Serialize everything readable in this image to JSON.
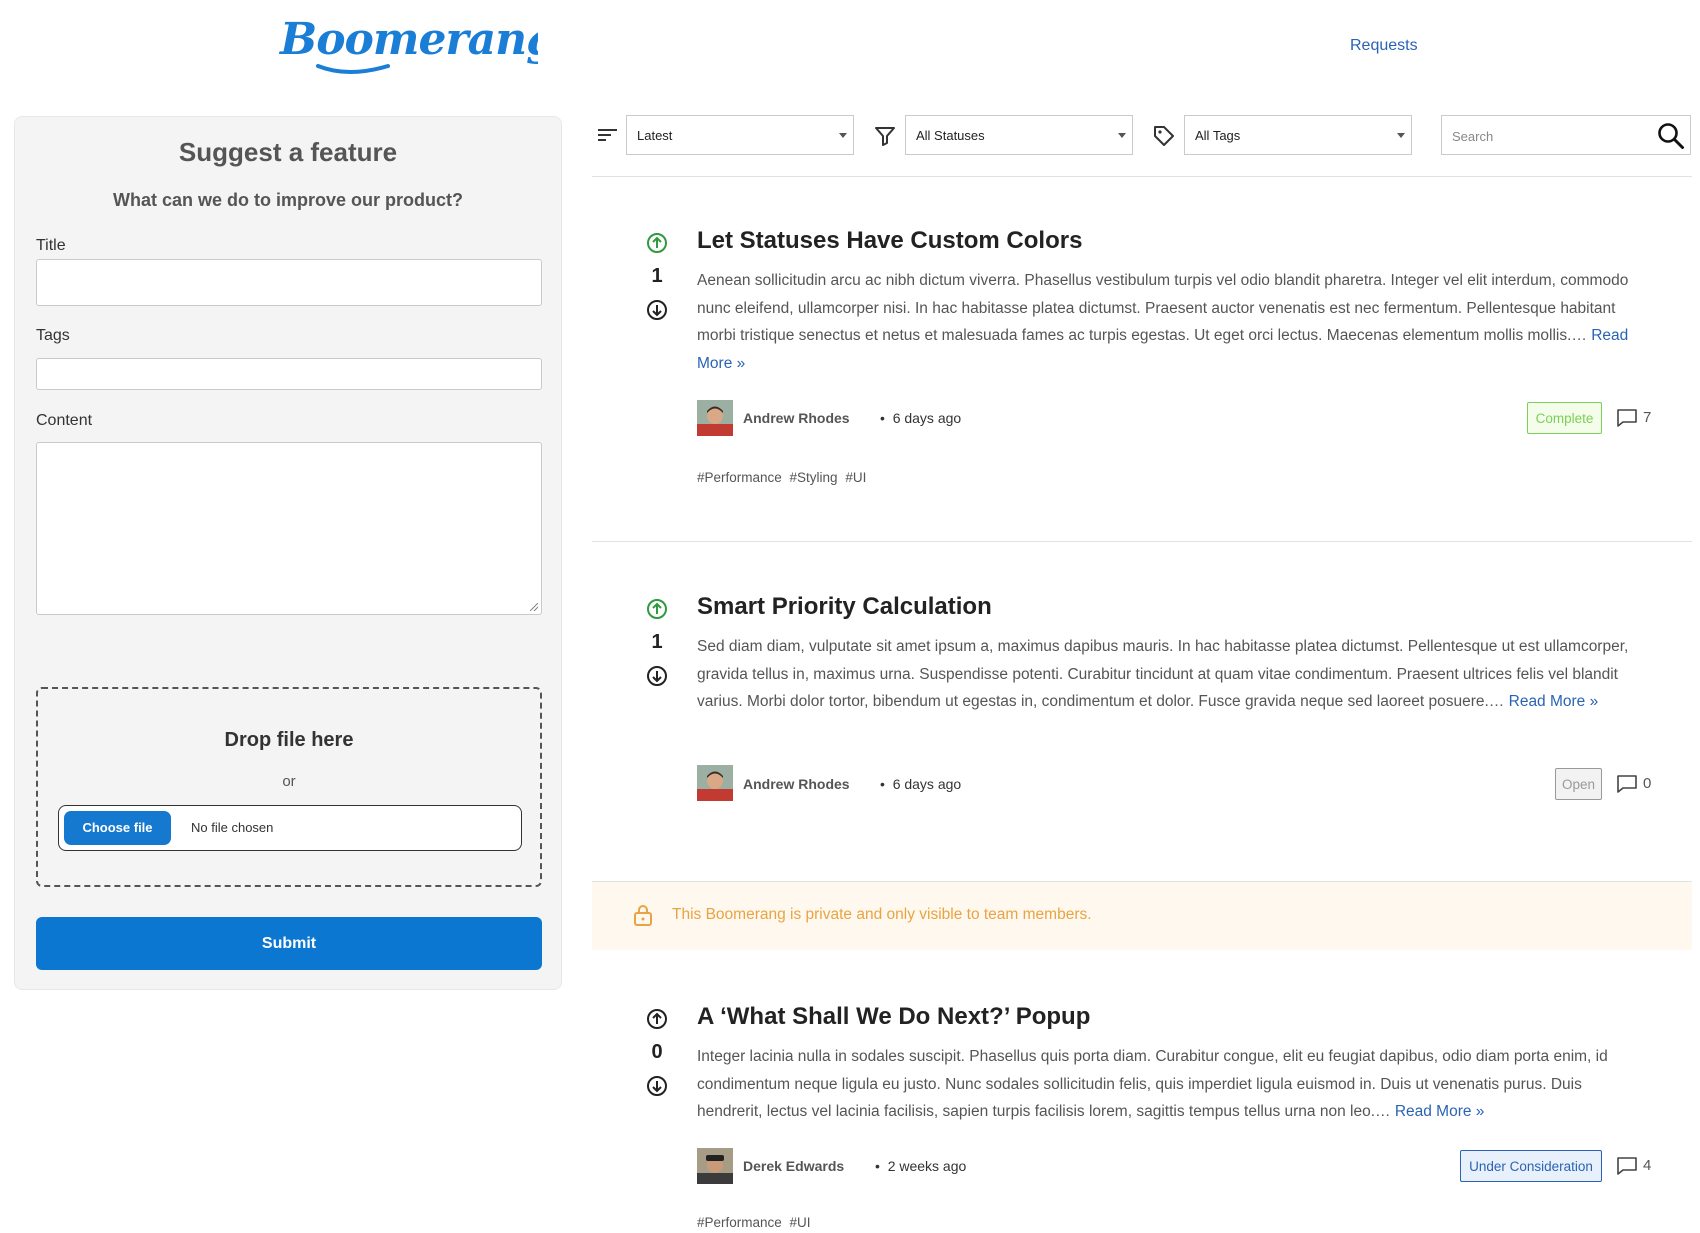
{
  "header": {
    "logo_text": "Boomerang",
    "nav": {
      "requests": "Requests"
    }
  },
  "suggest": {
    "title": "Suggest a feature",
    "subtitle": "What can we do to improve our product?",
    "title_label": "Title",
    "tags_label": "Tags",
    "content_label": "Content",
    "drop_title": "Drop file here",
    "drop_or": "or",
    "choose_file": "Choose file",
    "file_status": "No file chosen",
    "submit": "Submit"
  },
  "filters": {
    "sort": "Latest",
    "status": "All Statuses",
    "tags": "All Tags",
    "search_placeholder": "Search"
  },
  "posts": [
    {
      "title": "Let Statuses Have Custom Colors",
      "votes": "1",
      "body": "Aenean sollicitudin arcu ac nibh dictum viverra. Phasellus vestibulum turpis vel odio blandit pharetra. Integer vel elit interdum, commodo nunc eleifend, ullamcorper nisi. In hac habitasse platea dictumst. Praesent auctor venenatis est nec fermentum. Pellentesque habitant morbi tristique senectus et netus et malesuada fames ac turpis egestas. Ut eget orci lectus. Maecenas elementum mollis mollis.…",
      "read_more": "Read More »",
      "author": "Andrew Rhodes",
      "time": "6 days ago",
      "status": "Complete",
      "comments": "7",
      "tags": "#Performance #Styling #UI",
      "status_color": "#7ccf5a",
      "upvoted": true
    },
    {
      "title": "Smart Priority Calculation",
      "votes": "1",
      "body": "Sed diam diam, vulputate sit amet ipsum a, maximus dapibus mauris. In hac habitasse platea dictumst. Pellentesque ut est ullamcorper, gravida tellus in, maximus urna. Suspendisse potenti. Curabitur tincidunt at quam vitae condimentum. Praesent ultrices felis vel blandit varius. Morbi dolor tortor, bibendum ut egestas in, condimentum et dolor. Fusce gravida neque sed laoreet posuere.…",
      "read_more": "Read More »",
      "author": "Andrew Rhodes",
      "time": "6 days ago",
      "status": "Open",
      "comments": "0",
      "tags": "",
      "status_color": "#999999",
      "upvoted": true
    },
    {
      "title": "A ‘What Shall We Do Next?’ Popup",
      "votes": "0",
      "body": "Integer lacinia nulla in sodales suscipit. Phasellus quis porta diam. Curabitur congue, elit eu feugiat dapibus, odio diam porta enim, id condimentum neque ligula eu justo. Nunc sodales sollicitudin felis, quis imperdiet ligula euismod in. Duis ut venenatis purus. Duis hendrerit, lectus vel lacinia facilisis, sapien turpis facilisis lorem, sagittis tempus tellus urna non leo.…",
      "read_more": "Read More »",
      "author": "Derek Edwards",
      "time": "2 weeks ago",
      "status": "Under Consideration",
      "comments": "4",
      "tags": "#Performance #UI",
      "status_color": "#2a63b4",
      "upvoted": false
    }
  ],
  "notice": "This Boomerang is private and only visible to team members.",
  "colors": {
    "primary": "#0b77d0",
    "link": "#2a63b4",
    "upvote": "#2e9b3e",
    "notice_bg": "#fff8ee",
    "notice_text": "#e8a442"
  }
}
